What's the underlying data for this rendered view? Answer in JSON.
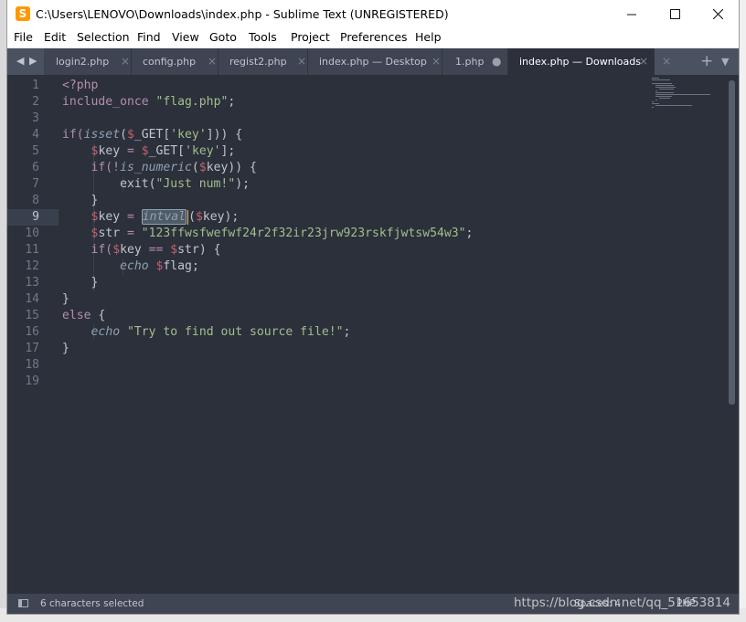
{
  "window": {
    "title": "C:\\Users\\LENOVO\\Downloads\\index.php - Sublime Text (UNREGISTERED)",
    "app_icon": "sublime-text-icon"
  },
  "menu": [
    "File",
    "Edit",
    "Selection",
    "Find",
    "View",
    "Goto",
    "Tools",
    "Project",
    "Preferences",
    "Help"
  ],
  "tabs": [
    {
      "label": "login2.php",
      "close": "×",
      "active": false,
      "dirty": false
    },
    {
      "label": "config.php",
      "close": "×",
      "active": false,
      "dirty": false
    },
    {
      "label": "regist2.php",
      "close": "×",
      "active": false,
      "dirty": false
    },
    {
      "label": "index.php — Desktop",
      "close": "×",
      "active": false,
      "dirty": false
    },
    {
      "label": "1.php",
      "close": "●",
      "active": false,
      "dirty": true
    },
    {
      "label": "index.php — Downloads",
      "close": "×",
      "active": true,
      "dirty": false
    }
  ],
  "editor": {
    "line_numbers": [
      "1",
      "2",
      "3",
      "4",
      "5",
      "6",
      "7",
      "8",
      "9",
      "10",
      "11",
      "12",
      "13",
      "14",
      "15",
      "16",
      "17",
      "18",
      "19"
    ],
    "current_line": 9,
    "tokens": {
      "l1": "<?php",
      "l2a": "include_once",
      "l2b": " ",
      "l2c": "\"flag.php\"",
      "l2d": ";",
      "l4a": "if(",
      "l4b": "isset",
      "l4c": "(",
      "l4d": "$",
      "l4e": "_GET[",
      "l4f": "'key'",
      "l4g": "])) {",
      "l5a": "    ",
      "l5b": "$",
      "l5c": "key",
      "l5d": " = ",
      "l5e": "$",
      "l5f": "_GET[",
      "l5g": "'key'",
      "l5h": "];",
      "l6a": "    if(!",
      "l6b": "is_numeric",
      "l6c": "(",
      "l6d": "$",
      "l6e": "key)) {",
      "l7a": "        exit(",
      "l7b": "\"Just num!\"",
      "l7c": ");",
      "l8": "    }",
      "l9a": "    ",
      "l9b": "$",
      "l9c": "key",
      "l9d": " = ",
      "l9e": "intval",
      "l9f": "(",
      "l9g": "$",
      "l9h": "key);",
      "l10a": "    ",
      "l10b": "$",
      "l10c": "str",
      "l10d": " = ",
      "l10e": "\"123ffwsfwefwf24r2f32ir23jrw923rskfjwtsw54w3\"",
      "l10f": ";",
      "l11a": "    if(",
      "l11b": "$",
      "l11c": "key",
      "l11d": " == ",
      "l11e": "$",
      "l11f": "str) {",
      "l12a": "        ",
      "l12b": "echo",
      "l12c": " ",
      "l12d": "$",
      "l12e": "flag;",
      "l13": "    }",
      "l14": "}",
      "l15a": "else",
      "l15b": " {",
      "l16a": "    ",
      "l16b": "echo",
      "l16c": " ",
      "l16d": "\"Try to find out source file!\"",
      "l16e": ";",
      "l17": "}"
    }
  },
  "status": {
    "selection": "6 characters selected",
    "indent": "Spaces: 4",
    "syntax": "PHP",
    "watermark": "https://blog.csdn.net/qq_51653814"
  },
  "colors": {
    "editor_bg": "#2b303b",
    "keyword": "#b48ead",
    "function": "#8fa1b3",
    "string": "#a3be8c",
    "variable": "#bf616a",
    "caret": "#f9ae58"
  }
}
